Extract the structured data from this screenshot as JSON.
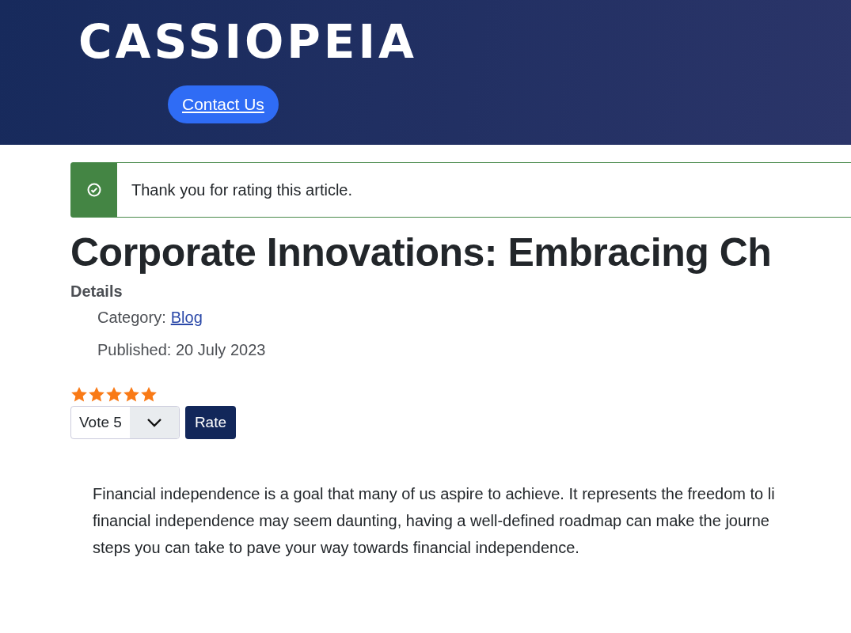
{
  "header": {
    "logo": "CASSIOPEIA",
    "nav": [
      {
        "label": "Contact Us"
      }
    ]
  },
  "alert": {
    "kind": "success",
    "message": "Thank you for rating this article."
  },
  "article": {
    "title": "Corporate Innovations: Embracing Ch",
    "details": {
      "heading": "Details",
      "category_label": "Category:",
      "category": "Blog",
      "published": "Published: 20 July 2023"
    },
    "rating": {
      "stars": 5,
      "vote": "Vote 5",
      "button": "Rate"
    },
    "body": "Financial independence is a goal that many of us aspire to achieve. It represents the freedom to li\nfinancial independence may seem daunting, having a well-defined roadmap can make the journe\nsteps you can take to pave your way towards financial independence."
  }
}
